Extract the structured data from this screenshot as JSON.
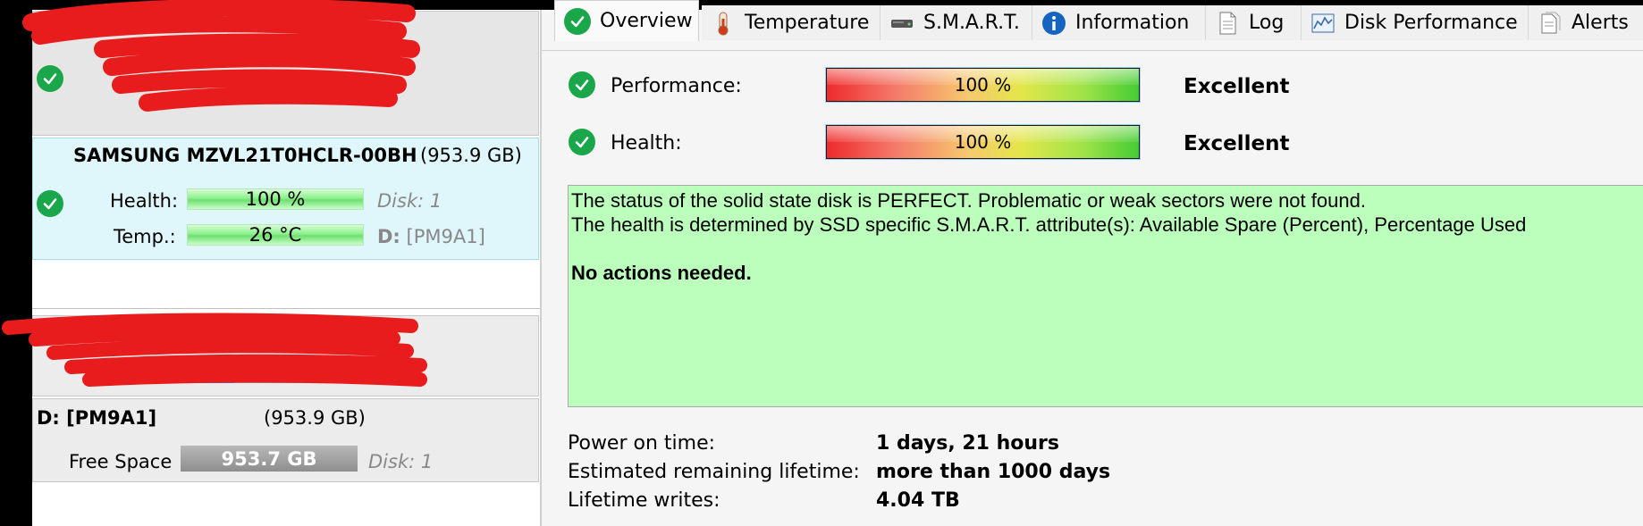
{
  "left": {
    "selected_drive": {
      "model": "SAMSUNG MZVL21T0HCLR-00BH",
      "size": "(953.9 GB)",
      "health_label": "Health:",
      "health_value": "100 %",
      "temp_label": "Temp.:",
      "temp_value": "26 °C",
      "disk_label": "Disk: 1",
      "volume_prefix": "D:",
      "volume_name": "[PM9A1]"
    },
    "volume_d": {
      "title": "D: [PM9A1]",
      "size": "(953.9 GB)",
      "free_label": "Free Space",
      "free_value": "953.7 GB",
      "disk_label": "Disk: 1"
    }
  },
  "tabs": [
    {
      "label": "Overview",
      "icon": "check-icon"
    },
    {
      "label": "Temperature",
      "icon": "thermometer-icon"
    },
    {
      "label": "S.M.A.R.T.",
      "icon": "drive-icon"
    },
    {
      "label": "Information",
      "icon": "info-icon"
    },
    {
      "label": "Log",
      "icon": "document-icon"
    },
    {
      "label": "Disk Performance",
      "icon": "chart-icon"
    },
    {
      "label": "Alerts",
      "icon": "alerts-icon"
    }
  ],
  "overview": {
    "performance": {
      "label": "Performance:",
      "value": "100 %",
      "rating": "Excellent",
      "level": 1.0
    },
    "health": {
      "label": "Health:",
      "value": "100 %",
      "rating": "Excellent",
      "level": 1.0
    },
    "status_line1": "The status of the solid state disk is PERFECT. Problematic or weak sectors were not found.",
    "status_line2": "The health is determined by SSD specific S.M.A.R.T. attribute(s):  Available Spare (Percent), Percentage Used",
    "status_action": "No actions needed.",
    "power_on_label": "Power on time:",
    "power_on_value": "1 days, 21 hours",
    "remaining_label": "Estimated remaining lifetime:",
    "remaining_value": "more than 1000 days",
    "writes_label": "Lifetime writes:",
    "writes_value": "4.04 TB"
  },
  "colors": {
    "status_background": "#bcffbc",
    "check_green": "#1aa64a",
    "redaction": "#e81c1c"
  }
}
